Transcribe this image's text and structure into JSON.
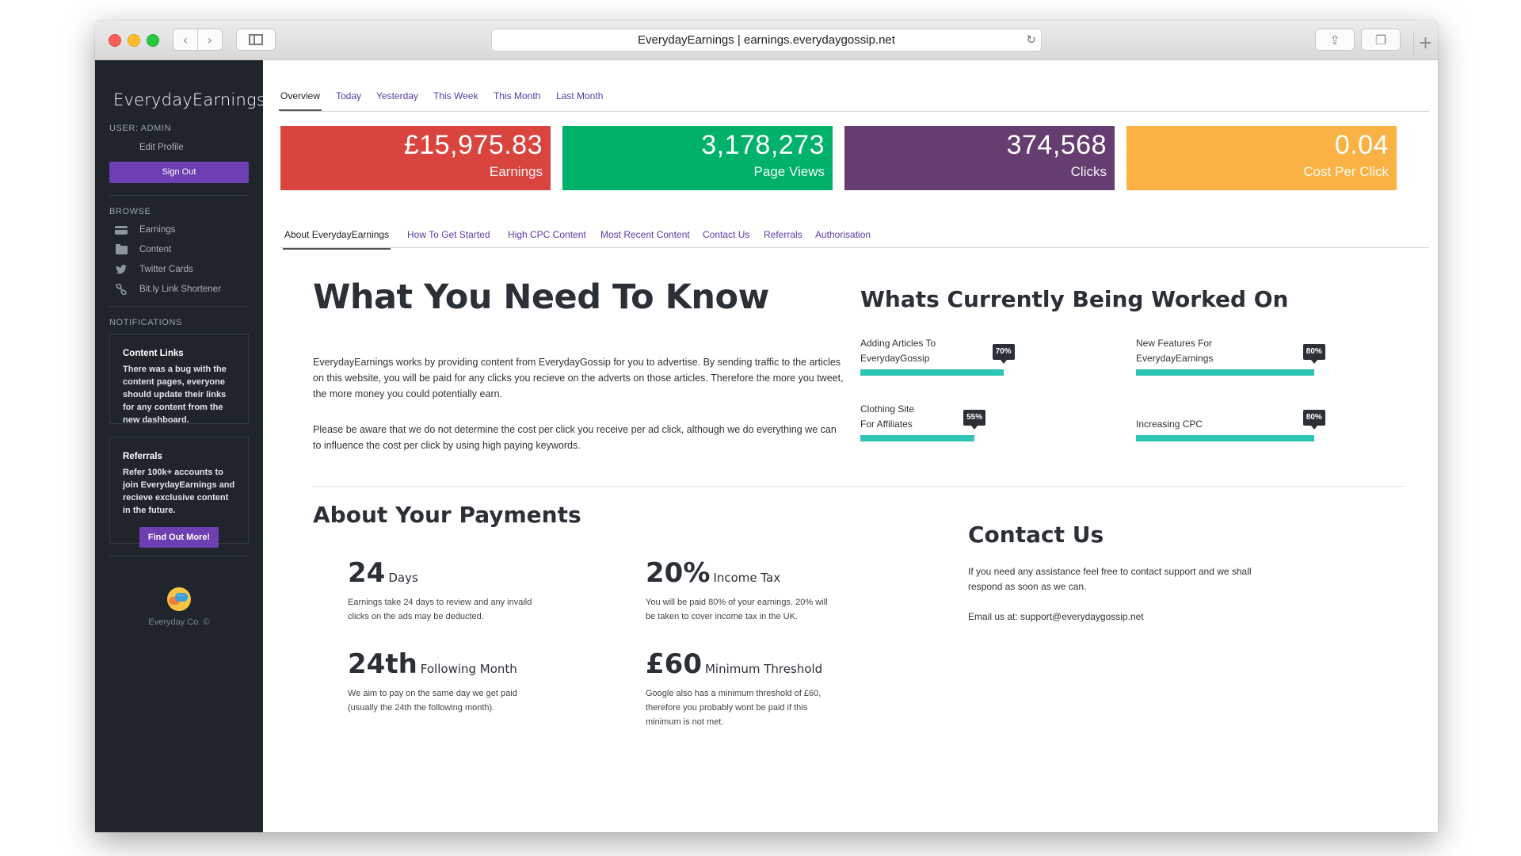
{
  "browser": {
    "address": "EverydayEarnings | earnings.everydaygossip.net"
  },
  "sidebar": {
    "logo": "EverydayEarnings",
    "user_heading": "USER: ADMIN",
    "edit_profile": "Edit Profile",
    "sign_out": "Sign Out",
    "browse_heading": "BROWSE",
    "nav": [
      {
        "label": "Earnings",
        "icon": "card-icon"
      },
      {
        "label": "Content",
        "icon": "folder-icon"
      },
      {
        "label": "Twitter Cards",
        "icon": "twitter-icon"
      },
      {
        "label": "Bit.ly Link Shortener",
        "icon": "link-icon"
      }
    ],
    "notifications_heading": "NOTIFICATIONS",
    "notice1": {
      "title": "Content Links",
      "body": "There was a bug with the content pages, everyone should update their links for any content from the new dashboard."
    },
    "notice2": {
      "title": "Referrals",
      "body": "Refer 100k+ accounts to join EverydayEarnings and recieve exclusive content in the future.",
      "button": "Find Out More!"
    },
    "footer": "Everyday Co. ©"
  },
  "period_tabs": [
    "Overview",
    "Today",
    "Yesterday",
    "This Week",
    "This Month",
    "Last Month"
  ],
  "stats": [
    {
      "value": "£15,975.83",
      "label": "Earnings",
      "color": "#d9443f"
    },
    {
      "value": "3,178,273",
      "label": "Page Views",
      "color": "#00b16a"
    },
    {
      "value": "374,568",
      "label": "Clicks",
      "color": "#663d70"
    },
    {
      "value": "0.04",
      "label": "Cost Per Click",
      "color": "#fbb244"
    }
  ],
  "info_tabs": [
    "About EverydayEarnings",
    "How To Get Started",
    "High CPC Content",
    "Most Recent Content",
    "Contact Us",
    "Referrals",
    "Authorisation"
  ],
  "about": {
    "title": "What You Need To Know",
    "p1": "EverydayEarnings works by providing content from EverydayGossip for you to advertise. By sending traffic to the articles on this website, you will be paid for any clicks you recieve on the adverts on those articles. Therefore the more you tweet, the more money you could potentially earn.",
    "p2": "Please be aware that we do not determine the cost per click you receive per ad click, although we do everything we can to influence the cost per click by using high paying keywords."
  },
  "worked_on": {
    "title": "Whats Currently Being Worked On",
    "items": [
      {
        "label1": "Adding Articles To",
        "label2": "EverydayGossip",
        "percent": 70,
        "percent_text": "70%"
      },
      {
        "label1": "New Features For",
        "label2": "EverydayEarnings",
        "percent": 80,
        "percent_text": "80%"
      },
      {
        "label1": "Clothing Site",
        "label2": "For Affiliates",
        "percent": 55,
        "percent_text": "55%"
      },
      {
        "label1": "",
        "label2": "Increasing CPC",
        "percent": 80,
        "percent_text": "80%"
      }
    ]
  },
  "payments": {
    "title": "About Your Payments",
    "facts": [
      {
        "num": "24",
        "unit": "Days",
        "desc": "Earnings take 24 days to review and any invaild clicks on the ads may be deducted."
      },
      {
        "num": "20%",
        "unit": "Income Tax",
        "desc": "You will be paid 80% of your earnings. 20% will be taken to cover income tax in the UK."
      },
      {
        "num": "24th",
        "unit": "Following Month",
        "desc": "We aim to pay on the same day we get paid (usually the 24th the following month)."
      },
      {
        "num": "£60",
        "unit": "Minimum Threshold",
        "desc": "Google also has a minimum threshold of £60, therefore you probably wont be paid if this minimum is not met."
      }
    ]
  },
  "contact": {
    "title": "Contact Us",
    "text": "If you need any assistance feel free to contact support and we shall respond as soon as we can.",
    "email": "Email us at: support@everydaygossip.net"
  }
}
